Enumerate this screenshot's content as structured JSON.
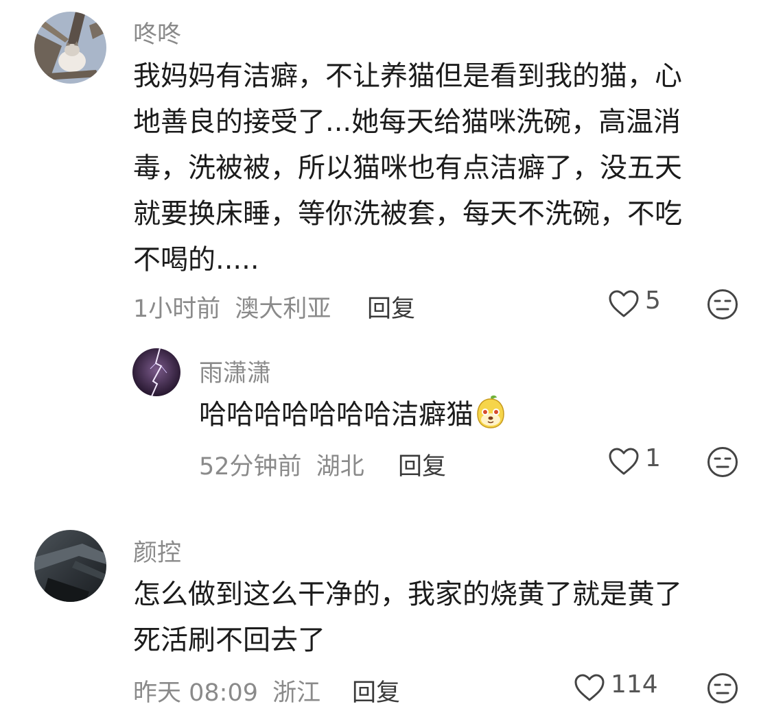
{
  "comments": [
    {
      "username": "咚咚",
      "text": "我妈妈有洁癖，不让养猫但是看到我的猫，心地善良的接受了...她每天给猫咪洗碗，高温消毒，洗被被，所以猫咪也有点洁癖了，没五天就要换床睡，等你洗被套，每天不洗碗，不吃不喝的.....",
      "lines": [
        "我妈妈有洁癖，不让养猫但是看到我的猫，心",
        "地善良的接受了...她每天给猫咪洗碗，高温消",
        "毒，洗被被，所以猫咪也有点洁癖了，没五天",
        "就要换床睡，等你洗被套，每天不洗碗，不吃",
        "不喝的....."
      ],
      "time": "1小时前",
      "location": "澳大利亚",
      "reply_label": "回复",
      "likes": "5",
      "avatar_icon": "cat-in-tree-avatar"
    },
    {
      "username": "雨潇潇",
      "text": "哈哈哈哈哈哈哈洁癖猫",
      "time": "52分钟前",
      "location": "湖北",
      "reply_label": "回复",
      "likes": "1",
      "avatar_icon": "lightning-avatar",
      "emoji_icon": "cute-pear-emoji"
    },
    {
      "username": "颜控",
      "text": "怎么做到这么干净的，我家的烧黄了就是黄了死活刷不回去了",
      "lines": [
        "怎么做到这么干净的，我家的烧黄了就是黄了",
        "死活刷不回去了"
      ],
      "time": "昨天 08:09",
      "location": "浙江",
      "reply_label": "回复",
      "likes": "114",
      "avatar_icon": "dark-abstract-avatar"
    }
  ],
  "icons": {
    "like": "heart-outline-icon",
    "dislike": "meh-face-icon"
  },
  "colors": {
    "username": "#8a8a8a",
    "text": "#1b1b1b",
    "meta": "#8a8a8a"
  }
}
